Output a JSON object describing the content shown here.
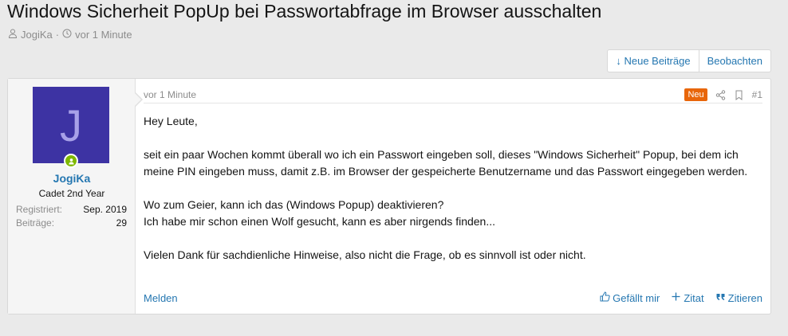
{
  "thread": {
    "title": "Windows Sicherheit PopUp bei Passwortabfrage im Browser ausschalten",
    "author": "JogiKa",
    "separator": "·",
    "time": "vor 1 Minute"
  },
  "buttons": {
    "new_posts": "↓ Neue Beiträge",
    "watch": "Beobachten"
  },
  "user": {
    "avatar_letter": "J",
    "name": "JogiKa",
    "title": "Cadet 2nd Year",
    "stats": [
      {
        "label": "Registriert:",
        "value": "Sep. 2019"
      },
      {
        "label": "Beiträge:",
        "value": "29"
      }
    ]
  },
  "post": {
    "time": "vor 1 Minute",
    "badge": "Neu",
    "number": "#1",
    "paragraphs": [
      "Hey Leute,",
      "seit ein paar Wochen kommt überall wo ich ein Passwort eingeben soll, dieses \"Windows Sicherheit\" Popup, bei dem ich meine PIN eingeben muss, damit z.B. im Browser der gespeicherte Benutzername und das Passwort eingegeben werden.",
      "Wo zum Geier, kann ich das (Windows Popup) deaktivieren?",
      "Ich habe mir schon einen Wolf gesucht, kann es aber nirgends finden...",
      "Vielen Dank für sachdienliche Hinweise, also nicht die Frage, ob es sinnvoll ist oder nicht."
    ],
    "report": "Melden",
    "like": "Gefällt mir",
    "quote": "Zitat",
    "reply": "Zitieren"
  },
  "colors": {
    "link": "#2577b1",
    "avatar_bg": "#3d33a3",
    "badge": "#e8660a",
    "online": "#7fb900"
  }
}
